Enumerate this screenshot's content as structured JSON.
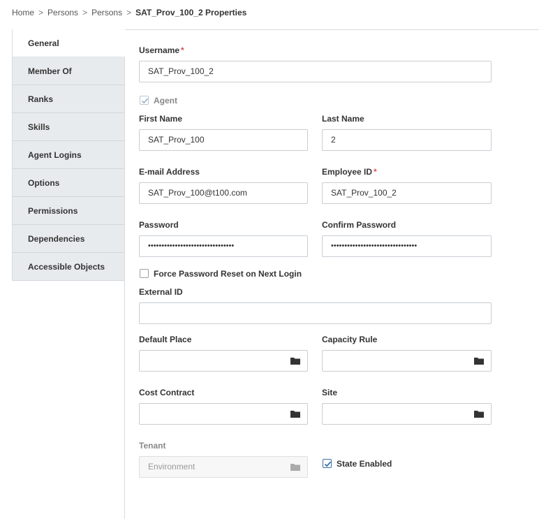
{
  "breadcrumb": {
    "items": [
      "Home",
      "Persons",
      "Persons"
    ],
    "separator": ">",
    "current": "SAT_Prov_100_2 Properties"
  },
  "sidebar": {
    "items": [
      {
        "label": "General",
        "active": true
      },
      {
        "label": "Member Of"
      },
      {
        "label": "Ranks"
      },
      {
        "label": "Skills"
      },
      {
        "label": "Agent Logins"
      },
      {
        "label": "Options"
      },
      {
        "label": "Permissions"
      },
      {
        "label": "Dependencies"
      },
      {
        "label": "Accessible Objects"
      }
    ]
  },
  "form": {
    "username": {
      "label": "Username",
      "value": "SAT_Prov_100_2",
      "required": "*"
    },
    "agent": {
      "label": "Agent",
      "checked": true
    },
    "first_name": {
      "label": "First Name",
      "value": "SAT_Prov_100"
    },
    "last_name": {
      "label": "Last Name",
      "value": "2"
    },
    "email": {
      "label": "E-mail Address",
      "value": "SAT_Prov_100@t100.com"
    },
    "employee_id": {
      "label": "Employee ID",
      "value": "SAT_Prov_100_2",
      "required": "*"
    },
    "password": {
      "label": "Password",
      "value": "••••••••••••••••••••••••••••••••"
    },
    "confirm_password": {
      "label": "Confirm Password",
      "value": "••••••••••••••••••••••••••••••••"
    },
    "force_reset": {
      "label": "Force Password Reset on Next Login",
      "checked": false
    },
    "external_id": {
      "label": "External ID",
      "value": ""
    },
    "default_place": {
      "label": "Default Place",
      "value": ""
    },
    "capacity_rule": {
      "label": "Capacity Rule",
      "value": ""
    },
    "cost_contract": {
      "label": "Cost Contract",
      "value": ""
    },
    "site": {
      "label": "Site",
      "value": ""
    },
    "tenant": {
      "label": "Tenant",
      "value": "Environment"
    },
    "state_enabled": {
      "label": "State Enabled",
      "checked": true
    }
  },
  "colors": {
    "accent": "#3a6ea5",
    "required": "#d9534f",
    "sidebar_bg": "#e8ebee"
  },
  "icons": {
    "browse": "folder-icon",
    "check": "checkmark-icon"
  }
}
